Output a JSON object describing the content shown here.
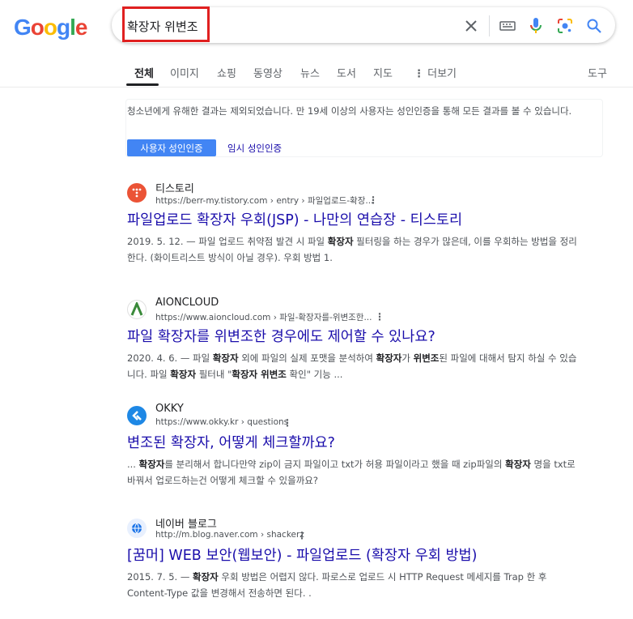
{
  "logo": {
    "text": "Google",
    "letters": [
      {
        "ch": "G",
        "color": "#4285F4"
      },
      {
        "ch": "o",
        "color": "#EA4335"
      },
      {
        "ch": "o",
        "color": "#FBBC05"
      },
      {
        "ch": "g",
        "color": "#4285F4"
      },
      {
        "ch": "l",
        "color": "#34A853"
      },
      {
        "ch": "e",
        "color": "#EA4335"
      }
    ]
  },
  "search": {
    "query": "확장자 위변조"
  },
  "tabs": [
    "전체",
    "이미지",
    "쇼핑",
    "동영상",
    "뉴스",
    "도서",
    "지도",
    "더보기"
  ],
  "tools_label": "도구",
  "safe_search": {
    "message": "청소년에게 유해한 결과는 제외되었습니다. 만 19세 이상의 사용자는 성인인증을 통해 모든 결과를 볼 수 있습니다.",
    "verify_button": "사용자 성인인증",
    "temp_link": "임시 성인인증"
  },
  "results": [
    {
      "site": "티스토리",
      "url": "https://berr-my.tistory.com › entry › 파일업로드-확장...",
      "title": "파일업로드 확장자 우회(JSP) - 나만의 연습장 - 티스토리",
      "snippet_html": "2019. 5. 12. — 파일 업로드 취약점 발견 시 파일 <b>확장자</b> 필터링을 하는 경우가 많은데, 이를 우회하는 방법을 정리한다. (화이트리스트 방식이 아닐 경우). 우회 방법 1."
    },
    {
      "site": "AIONCLOUD",
      "url": "https://www.aioncloud.com › 파일-확장자를-위변조한...",
      "title": "파일 확장자를 위변조한 경우에도 제어할 수 있나요?",
      "snippet_html": "2020. 4. 6. — 파일 <b>확장자</b> 외에 파일의 실제 포맷을 분석하여 <b>확장자</b>가 <b>위변조</b>된 파일에 대해서 탐지 하실 수 있습니다. 파일 <b>확장자</b> 필터내 \"<b>확장자 위변조</b> 확인\" 기능 ..."
    },
    {
      "site": "OKKY",
      "url": "https://www.okky.kr › questions",
      "title": "변조된 확장자, 어떻게 체크할까요?",
      "snippet_html": "... <b>확장자</b>를 분리해서 합니다만약 zip이 금지 파일이고 txt가 허용 파일이라고 했을 때 zip파일의 <b>확장자</b> 명을 txt로 바꿔서 업로드하는건 어떻게 체크할 수 있을까요?"
    },
    {
      "site": "네이버 블로그",
      "url": "http://m.blog.naver.com › shackerz",
      "title": "[꿈머] WEB 보안(웹보안) - 파일업로드 (확장자 우회 방법)",
      "snippet_html": "2015. 7. 5. — <b>확장자</b> 우회 방법은 어렵지 않다. 파로스로 업로드 시 HTTP Request 메세지를 Trap 한 후 Content-Type 값을 변경해서 전송하면 된다. ."
    }
  ]
}
